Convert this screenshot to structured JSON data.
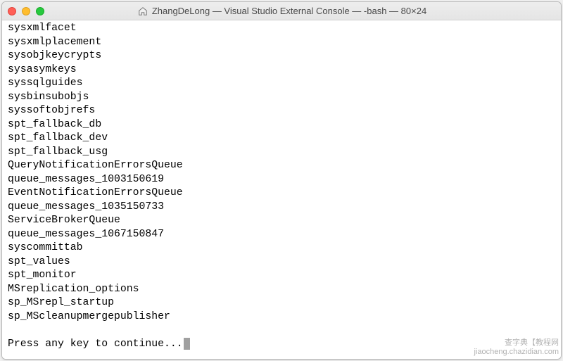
{
  "titlebar": {
    "title": "ZhangDeLong — Visual Studio External Console — -bash — 80×24"
  },
  "terminal": {
    "lines": [
      "sysxmlfacet",
      "sysxmlplacement",
      "sysobjkeycrypts",
      "sysasymkeys",
      "syssqlguides",
      "sysbinsubobjs",
      "syssoftobjrefs",
      "spt_fallback_db",
      "spt_fallback_dev",
      "spt_fallback_usg",
      "QueryNotificationErrorsQueue",
      "queue_messages_1003150619",
      "EventNotificationErrorsQueue",
      "queue_messages_1035150733",
      "ServiceBrokerQueue",
      "queue_messages_1067150847",
      "syscommittab",
      "spt_values",
      "spt_monitor",
      "MSreplication_options",
      "sp_MSrepl_startup",
      "sp_MScleanupmergepublisher"
    ],
    "prompt": "Press any key to continue..."
  },
  "watermark": {
    "line1": "查字典【教程网",
    "line2": "jiaocheng.chazidian.com"
  }
}
